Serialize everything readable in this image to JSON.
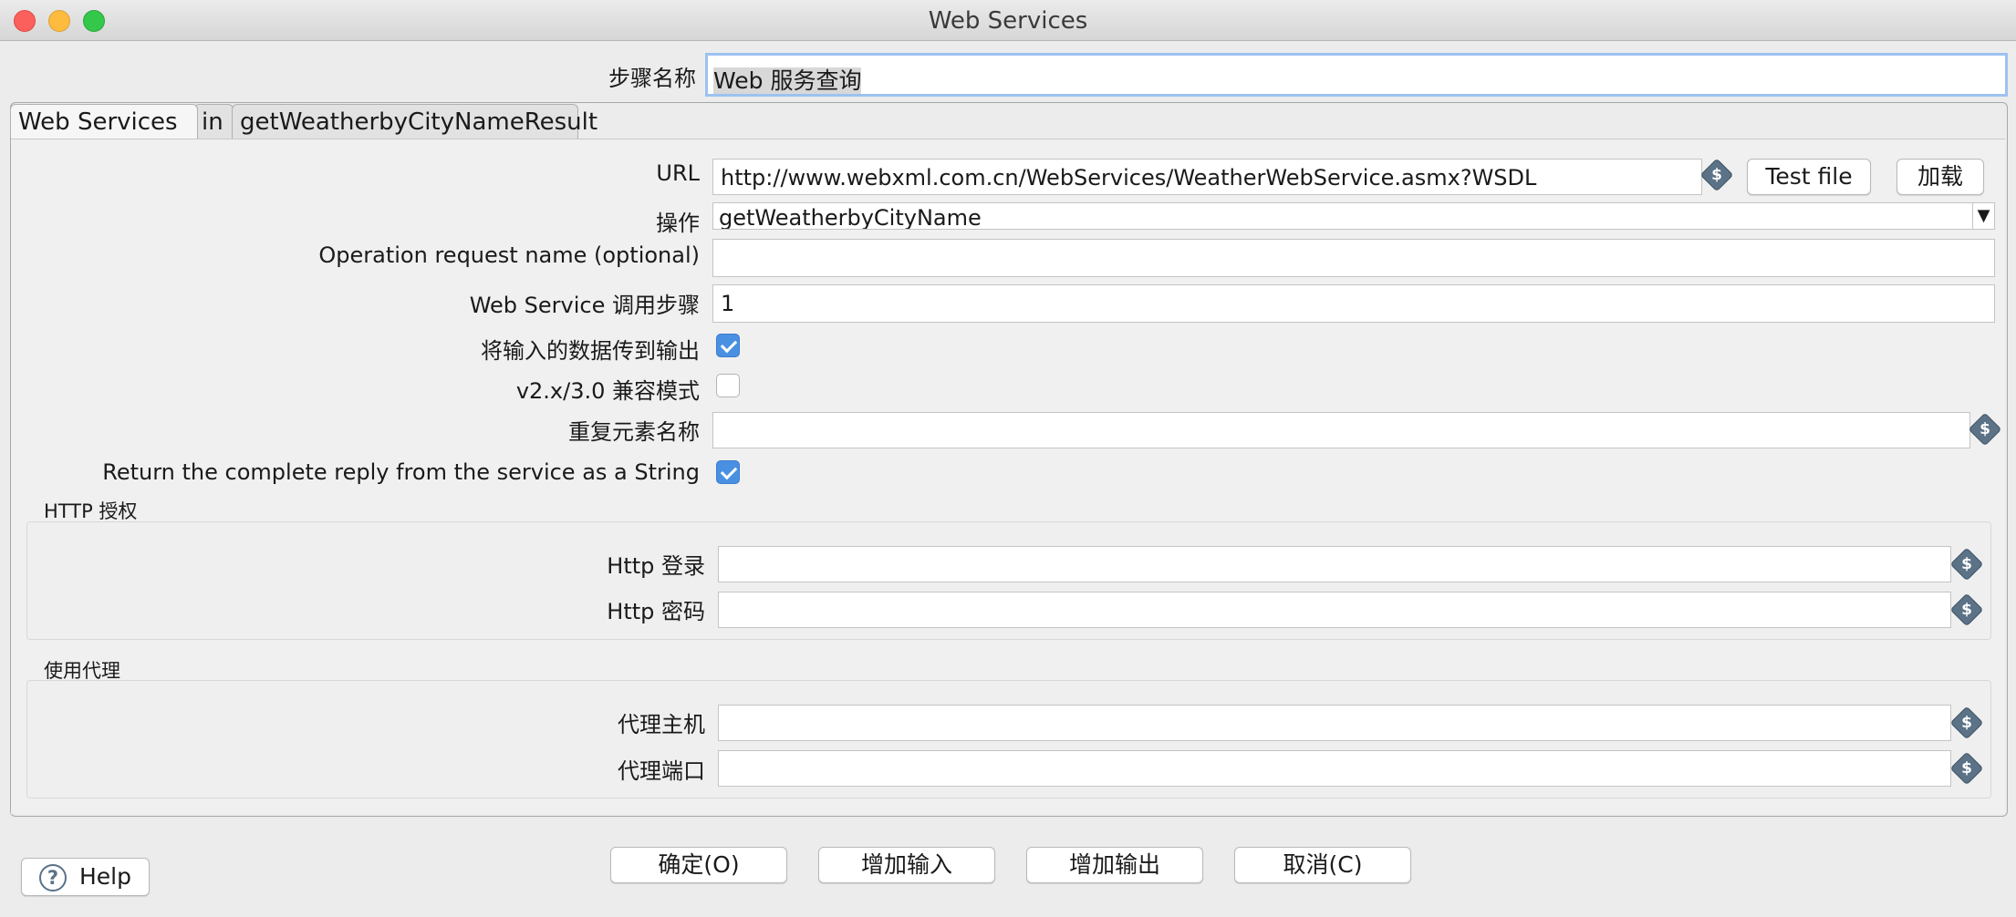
{
  "window": {
    "title": "Web Services"
  },
  "step_name": {
    "label": "步骤名称",
    "value": "Web 服务查询"
  },
  "tabs": [
    {
      "label": "Web Services"
    },
    {
      "label": "in"
    },
    {
      "label": "getWeatherbyCityNameResult"
    }
  ],
  "form": {
    "url_label": "URL",
    "url_value": "http://www.webxml.com.cn/WebServices/WeatherWebService.asmx?WSDL",
    "test_file_button": "Test file",
    "load_button": "加载",
    "operation_label": "操作",
    "operation_value": "getWeatherbyCityName",
    "op_request_label": "Operation request name (optional)",
    "op_request_value": "",
    "call_step_label": "Web Service 调用步骤",
    "call_step_value": "1",
    "pass_input_label": "将输入的数据传到输出",
    "pass_input_checked": true,
    "compat_label": "v2.x/3.0 兼容模式",
    "compat_checked": false,
    "repeat_label": "重复元素名称",
    "repeat_value": "",
    "complete_reply_label": "Return the complete reply from the service as a String",
    "complete_reply_checked": true
  },
  "http_auth": {
    "title": "HTTP 授权",
    "login_label": "Http 登录",
    "login_value": "",
    "password_label": "Http 密码",
    "password_value": ""
  },
  "proxy": {
    "title": "使用代理",
    "host_label": "代理主机",
    "host_value": "",
    "port_label": "代理端口",
    "port_value": ""
  },
  "footer": {
    "help": "Help",
    "ok": "确定(O)",
    "add_input": "增加输入",
    "add_output": "增加输出",
    "cancel": "取消(C)"
  },
  "icons": {
    "variable": "dollar-variable-icon",
    "help": "help-icon",
    "dropdown": "dropdown-arrow-icon",
    "checkmark": "checkmark-icon"
  },
  "dollar_glyph": "$",
  "help_glyph": "?",
  "arrow_glyph": "▼"
}
